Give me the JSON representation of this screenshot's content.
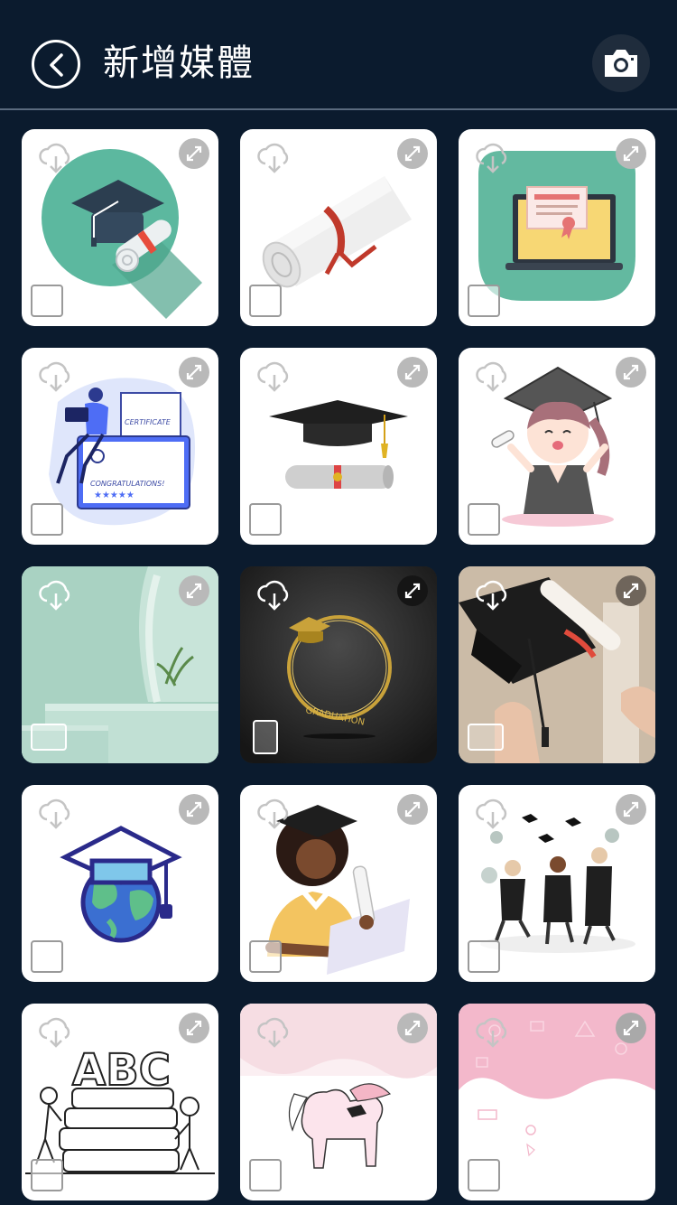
{
  "header": {
    "title": "新增媒體",
    "back_icon": "chevron-left-icon",
    "camera_icon": "camera-icon"
  },
  "colors": {
    "background": "#0b1b2e",
    "tile": "#ffffff",
    "divider": "#5a6a7e"
  },
  "tiles": [
    {
      "subject": "graduation-cap-and-diploma-circle"
    },
    {
      "subject": "rolled-diploma"
    },
    {
      "subject": "laptop-with-certificate"
    },
    {
      "subject": "woman-with-certificate",
      "labels": [
        "CERTIFICATE",
        "CONGRATULATIONS!"
      ]
    },
    {
      "subject": "graduation-cap-and-scroll"
    },
    {
      "subject": "anime-graduate-girl"
    },
    {
      "subject": "mint-podium-background",
      "type": "photo",
      "ratio": "horizontal"
    },
    {
      "subject": "golden-graduation-ring",
      "type": "photo",
      "ratio": "vertical",
      "labels": [
        "GRADUATION"
      ]
    },
    {
      "subject": "hand-holding-cap-and-diploma",
      "type": "photo",
      "ratio": "horizontal"
    },
    {
      "subject": "globe-with-graduation-cap"
    },
    {
      "subject": "graduate-woman-with-laptop"
    },
    {
      "subject": "graduates-jumping"
    },
    {
      "subject": "abc-books-outline",
      "labels": [
        "ABC"
      ]
    },
    {
      "subject": "unicorn-graduate"
    },
    {
      "subject": "pink-doodle-background"
    }
  ]
}
